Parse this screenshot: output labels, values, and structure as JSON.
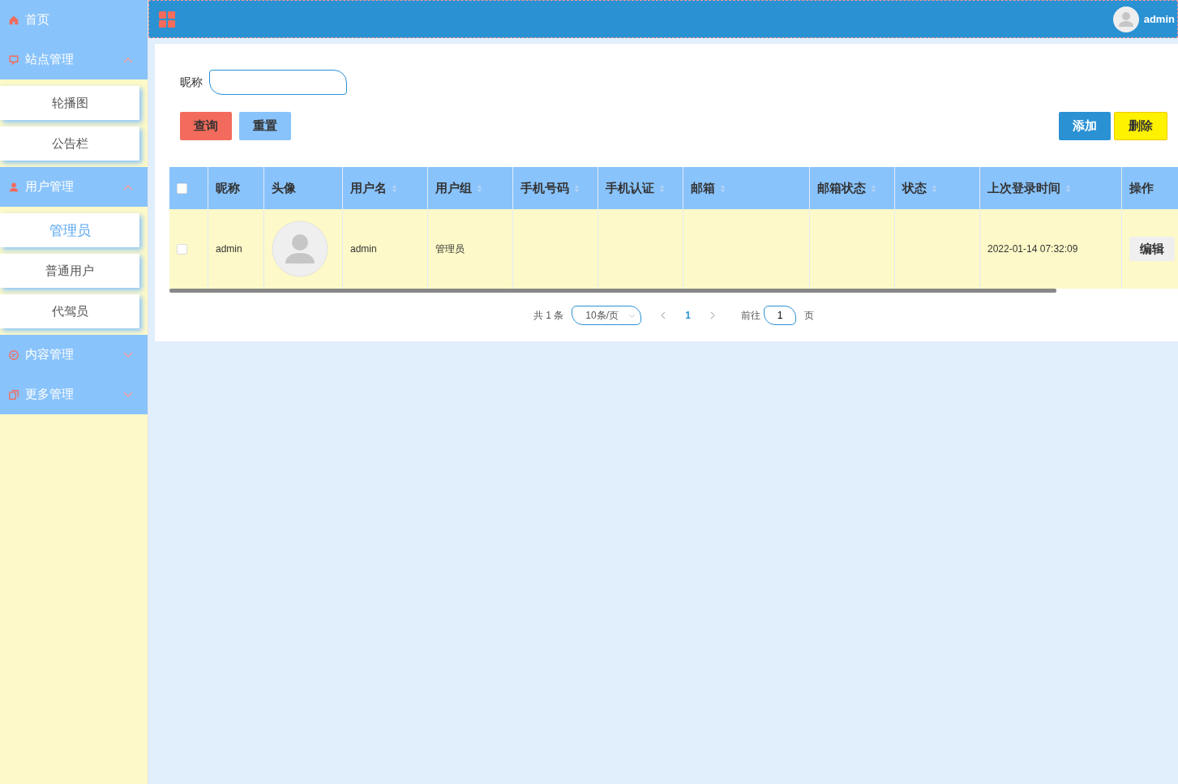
{
  "sidebar": {
    "items": [
      {
        "kind": "link",
        "label": "首页"
      },
      {
        "kind": "group",
        "label": "站点管理",
        "expanded": true,
        "children": [
          {
            "label": "轮播图",
            "selected": false
          },
          {
            "label": "公告栏",
            "selected": false
          }
        ]
      },
      {
        "kind": "group",
        "label": "用户管理",
        "expanded": true,
        "children": [
          {
            "label": "管理员",
            "selected": true
          },
          {
            "label": "普通用户",
            "selected": false
          },
          {
            "label": "代驾员",
            "selected": false
          }
        ]
      },
      {
        "kind": "group",
        "label": "内容管理",
        "expanded": false
      },
      {
        "kind": "group",
        "label": "更多管理",
        "expanded": false
      }
    ]
  },
  "header": {
    "username": "admin"
  },
  "search": {
    "label": "昵称"
  },
  "buttons": [
    {
      "label": "查询",
      "kind": "search"
    },
    {
      "label": "重置",
      "kind": "reset"
    },
    {
      "label": "添加",
      "kind": "add"
    },
    {
      "label": "删除",
      "kind": "delete"
    }
  ],
  "table": {
    "columns": [
      {
        "kind": "checkbox",
        "checked": false
      },
      {
        "kind": "nickname",
        "label": "昵称",
        "sortable": false
      },
      {
        "kind": "avatar",
        "label": "头像",
        "sortable": false
      },
      {
        "kind": "username",
        "label": "用户名",
        "sortable": true
      },
      {
        "kind": "group",
        "label": "用户组",
        "sortable": true
      },
      {
        "kind": "phone",
        "label": "手机号码",
        "sortable": true
      },
      {
        "kind": "phone_verified",
        "label": "手机认证",
        "sortable": true
      },
      {
        "kind": "email",
        "label": "邮箱",
        "sortable": true
      },
      {
        "kind": "email_status",
        "label": "邮箱状态",
        "sortable": true
      },
      {
        "kind": "status",
        "label": "状态",
        "sortable": true
      },
      {
        "kind": "last_login",
        "label": "上次登录时间",
        "sortable": true
      },
      {
        "kind": "action",
        "label": "操作",
        "sortable": false
      }
    ],
    "rows": [
      {
        "selected": false,
        "nickname": "admin",
        "avatar": true,
        "username": "admin",
        "group": "管理员",
        "last_login": "2022-01-14 07:32:09",
        "action": "编辑"
      }
    ]
  },
  "pagination": {
    "total": "共 1 条",
    "page_size": "10条/页",
    "pages": [
      {
        "label": "1",
        "selected": true
      }
    ],
    "goto_label": "前往",
    "goto_value": "1",
    "goto_suffix": "页"
  }
}
